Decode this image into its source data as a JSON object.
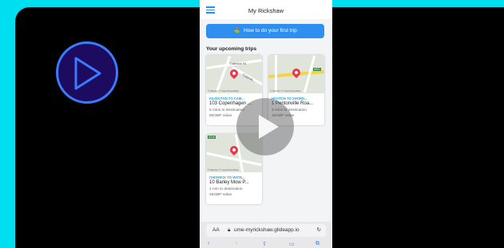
{
  "app": {
    "title": "My Rickshaw",
    "cta_label": "How to do your first trip"
  },
  "section_title": "Your upcoming trips",
  "trips": [
    {
      "route": "ISLINGTON TO CAM...",
      "address": "103 Copenhagen ...",
      "time": "5 mins to destination",
      "value": "80GBP value",
      "street": "Caledon St",
      "street2": "Copenh..."
    },
    {
      "route": "HOXTON TO SHORD...",
      "address": "1 Pentonville Roa...",
      "time": "3 mins to destination",
      "value": "19GBP value",
      "badge": "A501"
    },
    {
      "route": "CHISWICK TO WATE...",
      "address": "10 Barley Mow P...",
      "time": "1 min to destination",
      "value": "25GBP value",
      "badge": "A316"
    }
  ],
  "map_attribution": "© Mapbox © OpenStreetMap",
  "browser": {
    "text_size": "AA",
    "url": "ume-myrickshaw.glideapp.io"
  },
  "colors": {
    "frame": "#00dff0",
    "accent": "#2e8ff0",
    "pin": "#e8384a",
    "route": "#2d9fd8",
    "play_ring": "#3a7bff"
  },
  "icons": {
    "play": "play-icon",
    "menu": "hamburger-menu-icon",
    "cta": "route-icon",
    "lock": "lock-icon",
    "reload": "reload-icon",
    "pin": "map-pin-icon"
  }
}
